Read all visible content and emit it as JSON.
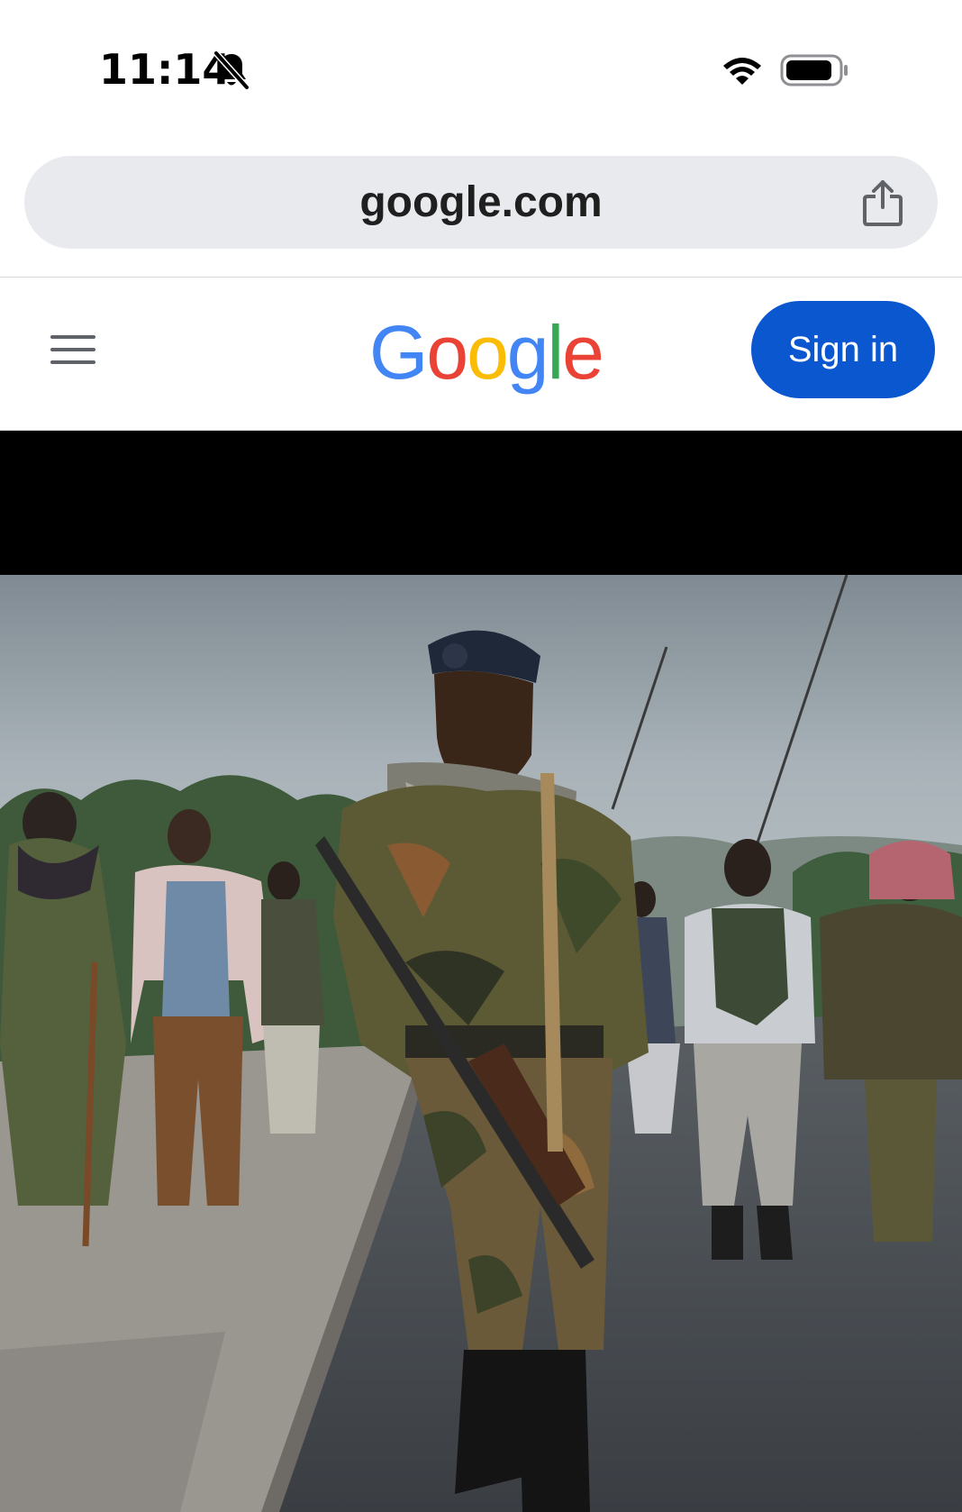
{
  "status_bar": {
    "time": "11:14",
    "icons": [
      "bell-off-icon",
      "wifi-icon",
      "battery-icon"
    ]
  },
  "browser": {
    "url": "google.com",
    "share_icon": "share-icon"
  },
  "header": {
    "menu_icon": "menu-icon",
    "logo": {
      "letters": [
        {
          "char": "G",
          "color": "#4285F4"
        },
        {
          "char": "o",
          "color": "#EA4335"
        },
        {
          "char": "o",
          "color": "#FBBC05"
        },
        {
          "char": "g",
          "color": "#4285F4"
        },
        {
          "char": "l",
          "color": "#34A853"
        },
        {
          "char": "e",
          "color": "#EA4335"
        }
      ]
    },
    "sign_in_label": "Sign in",
    "sign_in_color": "#0B57D0"
  },
  "content": {
    "image": "news-photo"
  }
}
